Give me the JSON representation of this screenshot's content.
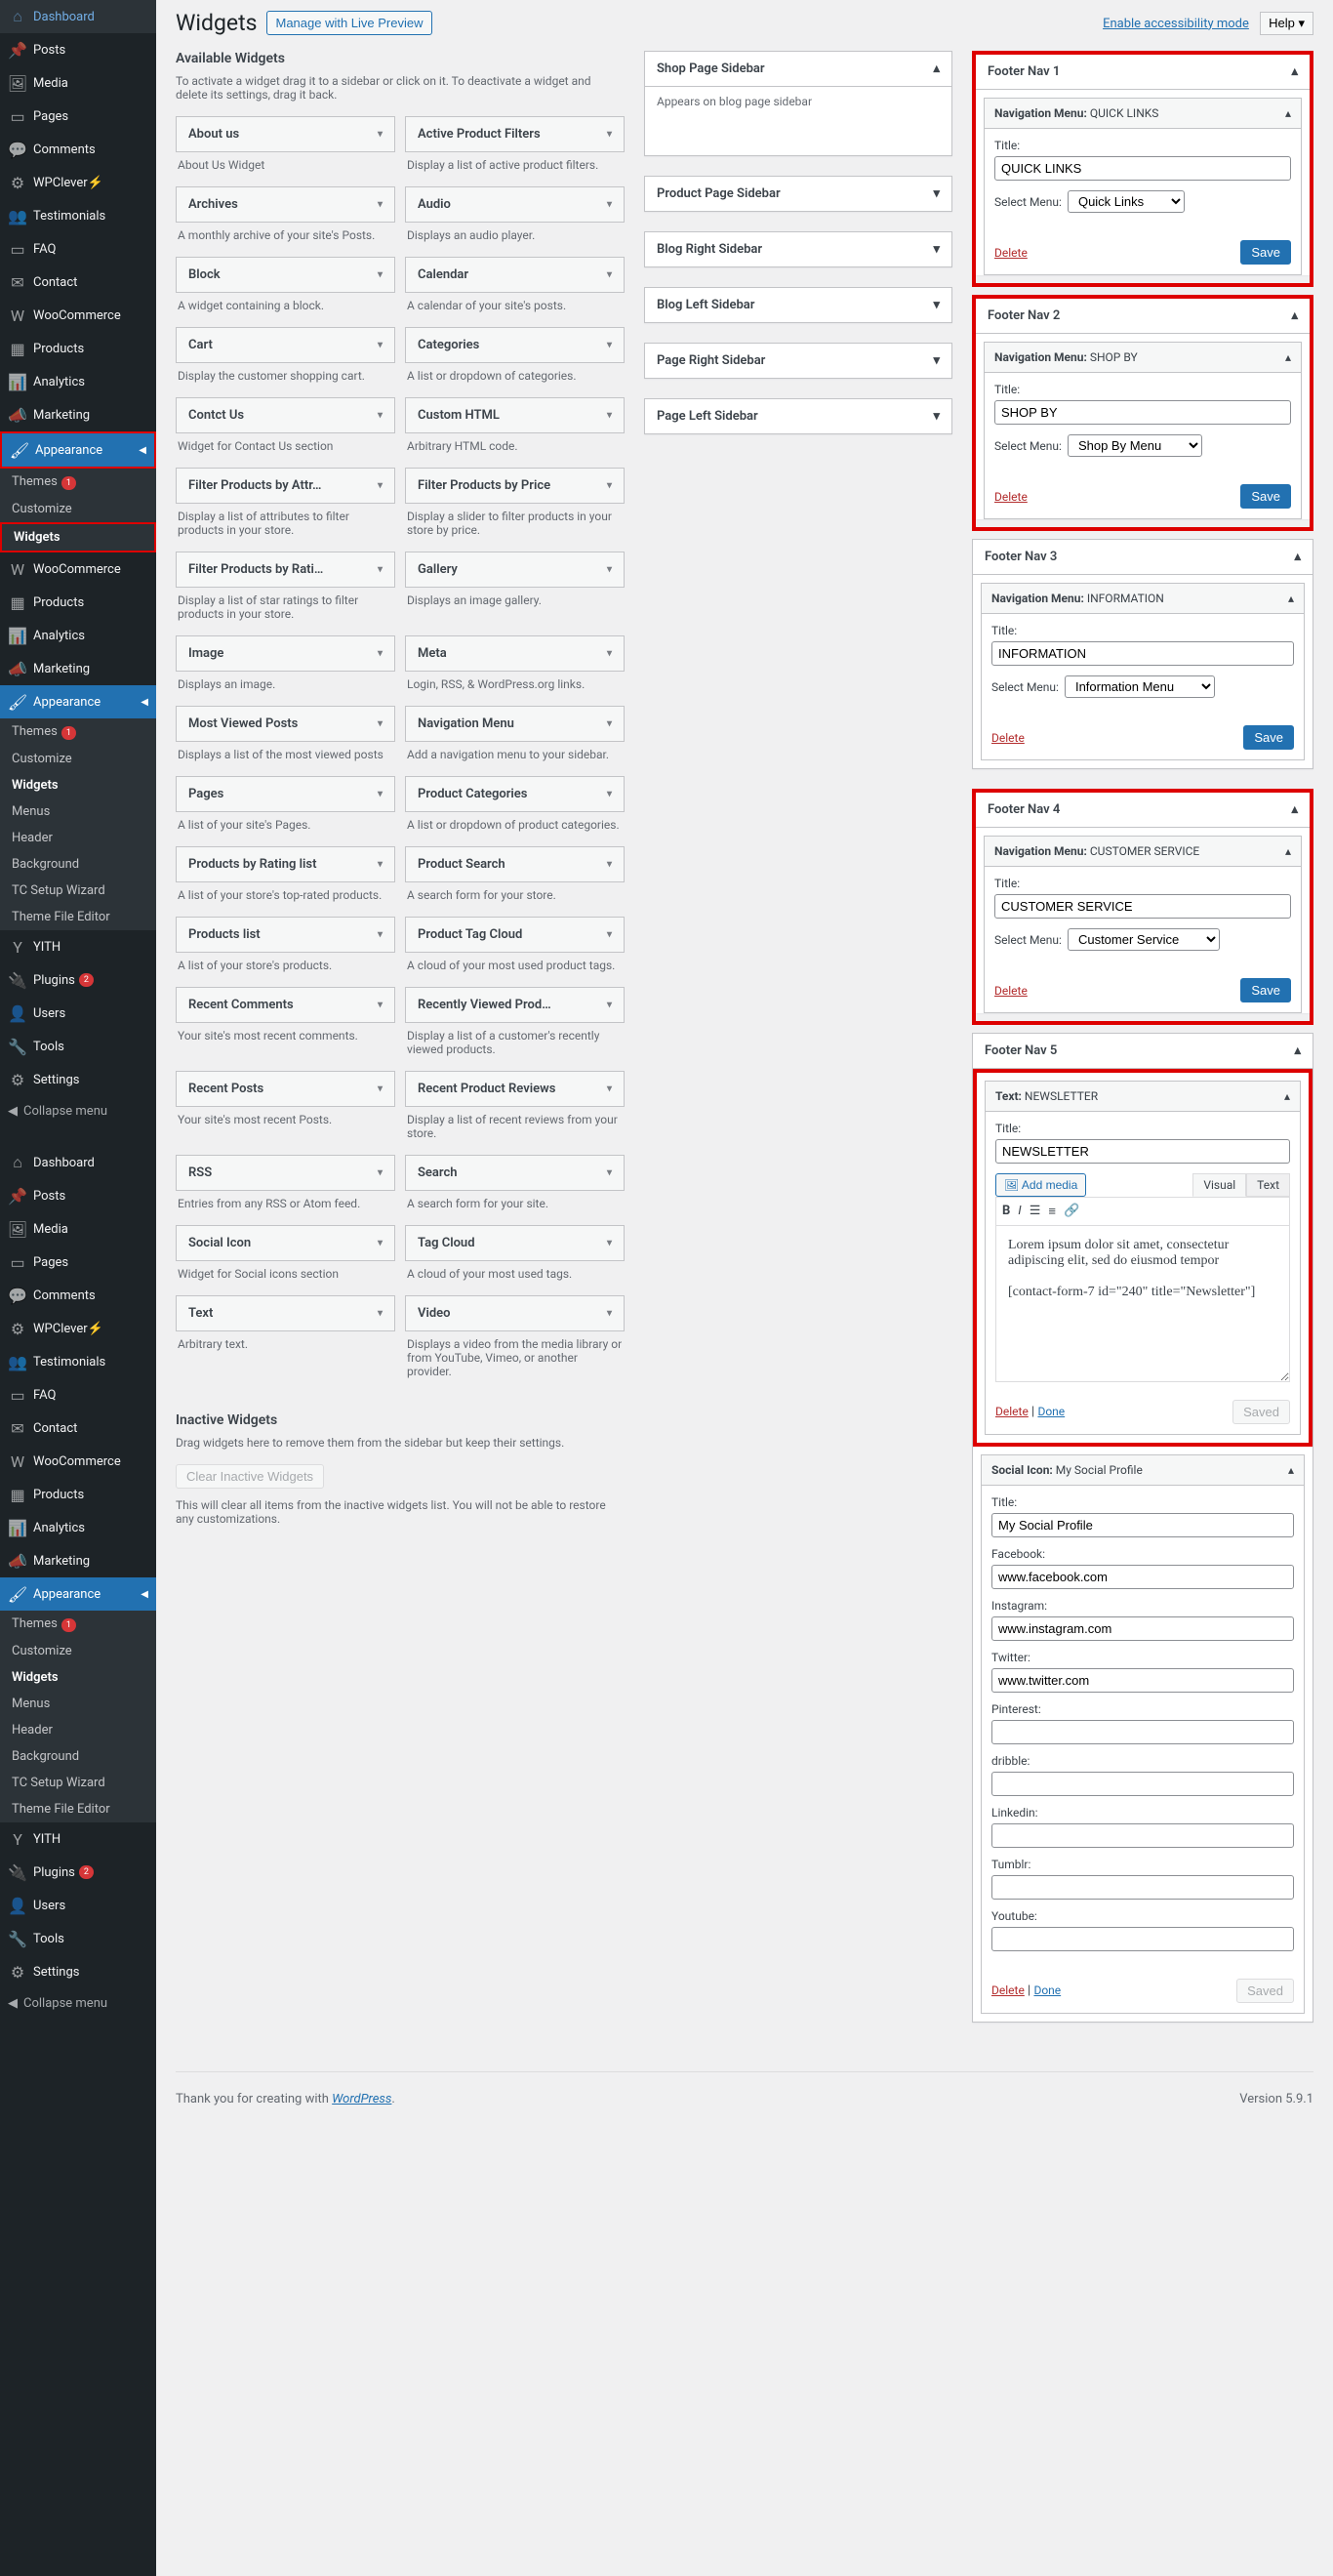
{
  "top": {
    "title": "Widgets",
    "live_preview": "Manage with Live Preview",
    "accessibility": "Enable accessibility mode",
    "help": "Help ▾"
  },
  "nav": {
    "dashboard": "Dashboard",
    "posts": "Posts",
    "media": "Media",
    "pages": "Pages",
    "comments": "Comments",
    "wpclever": "WPClever",
    "testimonials": "Testimonials",
    "faq": "FAQ",
    "contact": "Contact",
    "woocommerce": "WooCommerce",
    "products": "Products",
    "analytics": "Analytics",
    "marketing": "Marketing",
    "appearance": "Appearance",
    "themes": "Themes",
    "themes_badge": "1",
    "customize": "Customize",
    "widgets": "Widgets",
    "menus": "Menus",
    "header": "Header",
    "background": "Background",
    "tc_setup": "TC Setup Wizard",
    "theme_editor": "Theme File Editor",
    "yith": "YITH",
    "plugins": "Plugins",
    "plugins_badge": "2",
    "users": "Users",
    "tools": "Tools",
    "settings": "Settings",
    "collapse": "Collapse menu"
  },
  "available": {
    "heading": "Available Widgets",
    "desc": "To activate a widget drag it to a sidebar or click on it. To deactivate a widget and delete its settings, drag it back.",
    "items": [
      {
        "name": "About us",
        "desc": "About Us Widget"
      },
      {
        "name": "Active Product Filters",
        "desc": "Display a list of active product filters."
      },
      {
        "name": "Archives",
        "desc": "A monthly archive of your site's Posts."
      },
      {
        "name": "Audio",
        "desc": "Displays an audio player."
      },
      {
        "name": "Block",
        "desc": "A widget containing a block."
      },
      {
        "name": "Calendar",
        "desc": "A calendar of your site's posts."
      },
      {
        "name": "Cart",
        "desc": "Display the customer shopping cart."
      },
      {
        "name": "Categories",
        "desc": "A list or dropdown of categories."
      },
      {
        "name": "Contct Us",
        "desc": "Widget for Contact Us section"
      },
      {
        "name": "Custom HTML",
        "desc": "Arbitrary HTML code."
      },
      {
        "name": "Filter Products by Attr…",
        "desc": "Display a list of attributes to filter products in your store."
      },
      {
        "name": "Filter Products by Price",
        "desc": "Display a slider to filter products in your store by price."
      },
      {
        "name": "Filter Products by Rati…",
        "desc": "Display a list of star ratings to filter products in your store."
      },
      {
        "name": "Gallery",
        "desc": "Displays an image gallery."
      },
      {
        "name": "Image",
        "desc": "Displays an image."
      },
      {
        "name": "Meta",
        "desc": "Login, RSS, & WordPress.org links."
      },
      {
        "name": "Most Viewed Posts",
        "desc": "Displays a list of the most viewed posts"
      },
      {
        "name": "Navigation Menu",
        "desc": "Add a navigation menu to your sidebar."
      },
      {
        "name": "Pages",
        "desc": "A list of your site's Pages."
      },
      {
        "name": "Product Categories",
        "desc": "A list or dropdown of product categories."
      },
      {
        "name": "Products by Rating list",
        "desc": "A list of your store's top-rated products."
      },
      {
        "name": "Product Search",
        "desc": "A search form for your store."
      },
      {
        "name": "Products list",
        "desc": "A list of your store's products."
      },
      {
        "name": "Product Tag Cloud",
        "desc": "A cloud of your most used product tags."
      },
      {
        "name": "Recent Comments",
        "desc": "Your site's most recent comments."
      },
      {
        "name": "Recently Viewed Prod…",
        "desc": "Display a list of a customer's recently viewed products."
      },
      {
        "name": "Recent Posts",
        "desc": "Your site's most recent Posts."
      },
      {
        "name": "Recent Product Reviews",
        "desc": "Display a list of recent reviews from your store."
      },
      {
        "name": "RSS",
        "desc": "Entries from any RSS or Atom feed."
      },
      {
        "name": "Search",
        "desc": "A search form for your site."
      },
      {
        "name": "Social Icon",
        "desc": "Widget for Social icons section"
      },
      {
        "name": "Tag Cloud",
        "desc": "A cloud of your most used tags."
      },
      {
        "name": "Text",
        "desc": "Arbitrary text."
      },
      {
        "name": "Video",
        "desc": "Displays a video from the media library or from YouTube, Vimeo, or another provider."
      }
    ]
  },
  "inactive": {
    "heading": "Inactive Widgets",
    "desc": "Drag widgets here to remove them from the sidebar but keep their settings.",
    "clear_btn": "Clear Inactive Widgets",
    "clear_desc": "This will clear all items from the inactive widgets list. You will not be able to restore any customizations."
  },
  "mid_sidebars": [
    {
      "name": "Shop Page Sidebar",
      "desc": "Appears on blog page sidebar",
      "open": true
    },
    {
      "name": "Product Page Sidebar"
    },
    {
      "name": "Blog Right Sidebar"
    },
    {
      "name": "Blog Left Sidebar"
    },
    {
      "name": "Page Right Sidebar"
    },
    {
      "name": "Page Left Sidebar"
    }
  ],
  "footer_navs": [
    {
      "title": "Footer Nav 1",
      "menu_label": "Navigation Menu:",
      "menu_name": "QUICK LINKS",
      "title_label": "Title:",
      "title_val": "QUICK LINKS",
      "select_label": "Select Menu:",
      "select_val": "Quick Links",
      "delete": "Delete",
      "save": "Save"
    },
    {
      "title": "Footer Nav 2",
      "menu_label": "Navigation Menu:",
      "menu_name": "SHOP BY",
      "title_label": "Title:",
      "title_val": "SHOP BY",
      "select_label": "Select Menu:",
      "select_val": "Shop By Menu",
      "delete": "Delete",
      "save": "Save"
    },
    {
      "title": "Footer Nav 3",
      "menu_label": "Navigation Menu:",
      "menu_name": "INFORMATION",
      "title_label": "Title:",
      "title_val": "INFORMATION",
      "select_label": "Select Menu:",
      "select_val": "Information Menu",
      "delete": "Delete",
      "save": "Save"
    },
    {
      "title": "Footer Nav 4",
      "menu_label": "Navigation Menu:",
      "menu_name": "CUSTOMER SERVICE",
      "title_label": "Title:",
      "title_val": "CUSTOMER SERVICE",
      "select_label": "Select Menu:",
      "select_val": "Customer Service",
      "delete": "Delete",
      "save": "Save"
    }
  ],
  "footer_nav5": {
    "title": "Footer Nav 5",
    "text_head": "Text:",
    "text_head_val": "NEWSLETTER",
    "title_label": "Title:",
    "title_val": "NEWSLETTER",
    "add_media": "Add media",
    "tab_visual": "Visual",
    "tab_text": "Text",
    "content_line1": "Lorem ipsum dolor sit amet, consectetur adipiscing elit, sed do eiusmod tempor",
    "content_line2": "[contact-form-7 id=\"240\" title=\"Newsletter\"]",
    "delete": "Delete",
    "done": "Done",
    "saved": "Saved"
  },
  "social": {
    "head": "Social Icon:",
    "head_val": "My Social Profile",
    "title_label": "Title:",
    "title_val": "My Social Profile",
    "fb_label": "Facebook:",
    "fb_val": "www.facebook.com",
    "ig_label": "Instagram:",
    "ig_val": "www.instagram.com",
    "tw_label": "Twitter:",
    "tw_val": "www.twitter.com",
    "pi_label": "Pinterest:",
    "pi_val": "",
    "dr_label": "dribble:",
    "dr_val": "",
    "li_label": "Linkedin:",
    "li_val": "",
    "tu_label": "Tumblr:",
    "tu_val": "",
    "yt_label": "Youtube:",
    "yt_val": "",
    "delete": "Delete",
    "done": "Done",
    "saved": "Saved"
  },
  "footer": {
    "thanks": "Thank you for creating with ",
    "wp": "WordPress",
    "version": "Version 5.9.1"
  }
}
